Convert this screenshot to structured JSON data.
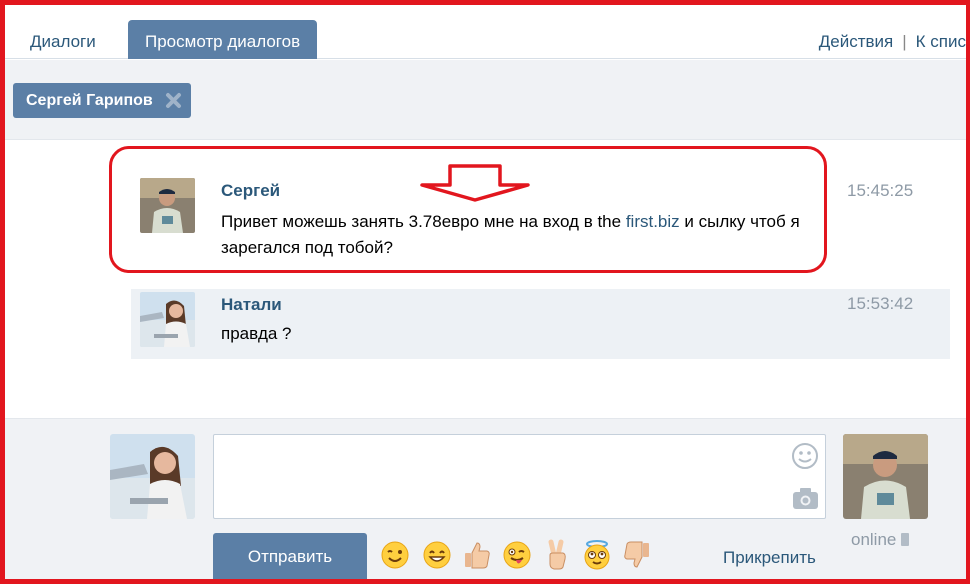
{
  "tabs": {
    "dialogs_label": "Диалоги",
    "view_dialogs_label": "Просмотр диалогов",
    "actions_label": "Действия",
    "separator": "|",
    "to_list_label": "К спис"
  },
  "filter_chip": {
    "name": "Сергей Гарипов"
  },
  "messages": [
    {
      "author": "Сергей",
      "text_before_link": "Привет можешь занять 3.78евро мне на вход в the ",
      "link": "first.biz",
      "text_after_link": " и сылку чтоб я зарегался под тобой?",
      "time": "15:45:25"
    },
    {
      "author": "Натали",
      "text": "правда ?",
      "time": "15:53:42"
    }
  ],
  "composer": {
    "placeholder": "",
    "send_label": "Отправить",
    "attach_label": "Прикрепить",
    "online_label": "online",
    "emojis": [
      "wink-emoji",
      "smile-emoji",
      "thumbs-up-emoji",
      "tongue-wink-emoji",
      "victory-hand-emoji",
      "angel-emoji",
      "thumbs-down-emoji"
    ]
  },
  "colors": {
    "accent": "#5b7fa6",
    "link": "#2b587a",
    "annotation_red": "#e2161e",
    "background_grey": "#f0f2f5"
  }
}
